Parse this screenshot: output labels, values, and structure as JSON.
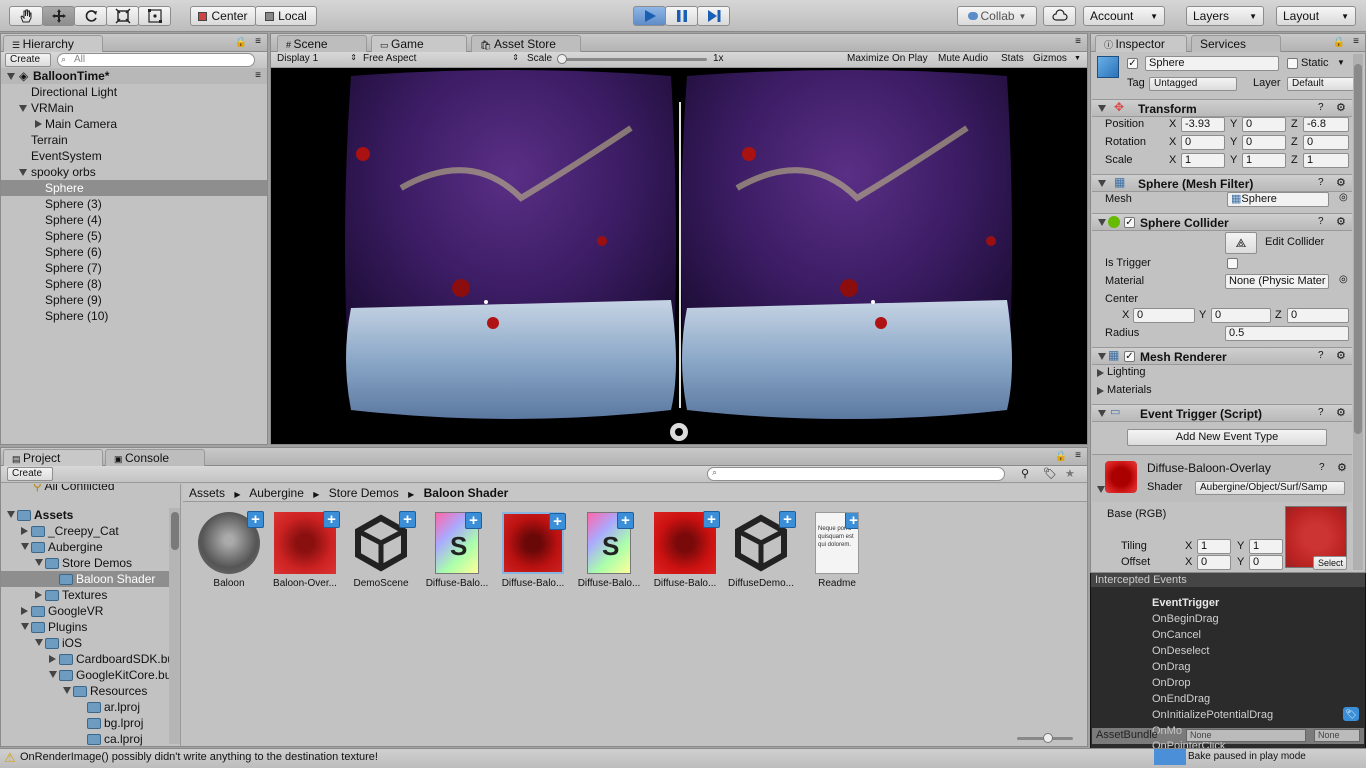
{
  "toolbar": {
    "center_label": "Center",
    "local_label": "Local",
    "collab_label": "Collab",
    "account_label": "Account",
    "layers_label": "Layers",
    "layout_label": "Layout"
  },
  "hierarchy": {
    "tab_label": "Hierarchy",
    "create_label": "Create",
    "search_placeholder": "All",
    "scene_name": "BalloonTime*",
    "items": [
      "Directional Light",
      "VRMain",
      "Main Camera",
      "Terrain",
      "EventSystem",
      "spooky orbs",
      "Sphere",
      "Sphere (3)",
      "Sphere (4)",
      "Sphere (5)",
      "Sphere (6)",
      "Sphere (7)",
      "Sphere (8)",
      "Sphere (9)",
      "Sphere (10)"
    ]
  },
  "center_tabs": [
    "Scene",
    "Game",
    "Asset Store"
  ],
  "game_bar": {
    "display": "Display 1",
    "aspect": "Free Aspect",
    "scale_label": "Scale",
    "scale_value": "1x",
    "maximize": "Maximize On Play",
    "mute": "Mute Audio",
    "stats": "Stats",
    "gizmos": "Gizmos"
  },
  "inspector": {
    "tab_label": "Inspector",
    "services_label": "Services",
    "object_name": "Sphere",
    "static_label": "Static",
    "tag_label": "Tag",
    "tag_value": "Untagged",
    "layer_label": "Layer",
    "layer_value": "Default",
    "transform_title": "Transform",
    "position_label": "Position",
    "rotation_label": "Rotation",
    "scale_label": "Scale",
    "axis_x": "X",
    "axis_y": "Y",
    "axis_z": "Z",
    "position": [
      "-3.93",
      "0",
      "-6.8"
    ],
    "rotation": [
      "0",
      "0",
      "0"
    ],
    "scale": [
      "1",
      "1",
      "1"
    ],
    "mesh_filter_title": "Sphere (Mesh Filter)",
    "mesh_label": "Mesh",
    "mesh_value": "Sphere",
    "collider_title": "Sphere Collider",
    "edit_collider": "Edit Collider",
    "is_trigger_label": "Is Trigger",
    "material_label": "Material",
    "material_value": "None (Physic Mater",
    "center_label": "Center",
    "center": [
      "0",
      "0",
      "0"
    ],
    "radius_label": "Radius",
    "radius_value": "0.5",
    "renderer_title": "Mesh Renderer",
    "lighting_label": "Lighting",
    "materials_label": "Materials",
    "event_trigger_title": "Event Trigger (Script)",
    "add_event_label": "Add New Event Type",
    "material_name": "Diffuse-Baloon-Overlay",
    "shader_label": "Shader",
    "shader_value": "Aubergine/Object/Surf/Samp",
    "base_label": "Base (RGB)",
    "tiling_label": "Tiling",
    "offset_label": "Offset",
    "tiling": [
      "1",
      "1"
    ],
    "offset": [
      "0",
      "0"
    ],
    "select_label": "Select"
  },
  "events_popup": {
    "header": "Intercepted Events",
    "items": [
      "EventTrigger",
      "OnBeginDrag",
      "OnCancel",
      "OnDeselect",
      "OnDrag",
      "OnDrop",
      "OnEndDrag",
      "OnInitializePotentialDrag",
      "OnMo",
      "OnPointerClick"
    ],
    "assetbundle_label": "AssetBundle",
    "bundle_none": "None",
    "variant_none": "None"
  },
  "project": {
    "tab_label": "Project",
    "console_label": "Console",
    "create_label": "Create",
    "tree": [
      "All Conflicted",
      "Assets",
      "_Creepy_Cat",
      "Aubergine",
      "Store Demos",
      "Baloon Shader",
      "Textures",
      "GoogleVR",
      "Plugins",
      "iOS",
      "CardboardSDK.bu",
      "GoogleKitCore.bu",
      "Resources",
      "ar.lproj",
      "bg.lproj",
      "ca.lproj"
    ],
    "breadcrumb": [
      "Assets",
      "Aubergine",
      "Store Demos",
      "Baloon Shader"
    ],
    "assets": [
      "Baloon",
      "Baloon-Over...",
      "DemoScene",
      "Diffuse-Balo...",
      "Diffuse-Balo...",
      "Diffuse-Balo...",
      "Diffuse-Balo...",
      "DiffuseDemo...",
      "Readme"
    ],
    "readme_snippet": "Neque porro quisquam est qui dolorem."
  },
  "status": {
    "message": "OnRenderImage() possibly didn't write anything to the destination texture!",
    "bake_message": "Bake paused in play mode"
  }
}
